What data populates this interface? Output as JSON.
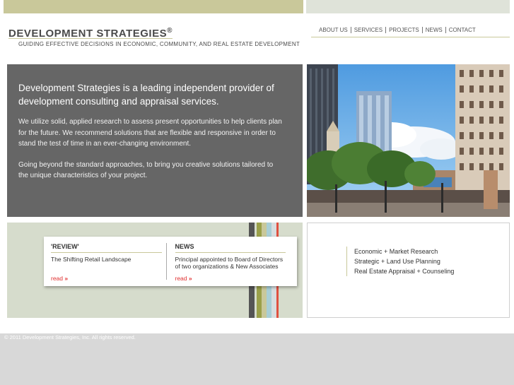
{
  "header": {
    "logo_text": "DEVELOPMENT STRATEGIES",
    "logo_mark": "®",
    "tagline": "GUIDING EFFECTIVE DECISIONS IN ECONOMIC, COMMUNITY, AND REAL ESTATE DEVELOPMENT"
  },
  "nav": {
    "items": [
      {
        "label": "ABOUT US"
      },
      {
        "label": "SERVICES"
      },
      {
        "label": "PROJECTS"
      },
      {
        "label": "NEWS"
      },
      {
        "label": "CONTACT"
      }
    ]
  },
  "hero": {
    "headline": "Development Strategies is a leading independent provider of development consulting and appraisal services.",
    "para1": "We utilize solid, applied research to assess present opportunities to help clients plan for the future. We recommend solutions that are flexible and responsive in order to stand the test of time in an ever-changing environment.",
    "para2": "Going beyond the standard approaches, to bring you creative solutions tailored to the unique characteristics of your project."
  },
  "cards": {
    "review": {
      "heading": "'REVIEW'",
      "text": "The Shifting Retail Landscape",
      "read": "read",
      "chevron": "»"
    },
    "news": {
      "heading": "NEWS",
      "text": "Principal appointed to Board of Directors of two organizations & New Associates",
      "read": "read",
      "chevron": "»"
    }
  },
  "services": {
    "items": [
      {
        "label": "Economic + Market Research"
      },
      {
        "label": "Strategic + Land Use Planning"
      },
      {
        "label": "Real Estate Appraisal + Counseling"
      }
    ]
  },
  "footer": {
    "copyright": "© 2011 Development Strategies, Inc.  All rights reserved."
  },
  "colors": {
    "olive": "#c9c89a",
    "hero_bg": "#666666",
    "panel_bg": "#d6dccc",
    "read_link": "#e03030",
    "stripes": [
      "#555555",
      "#9aa04a",
      "#c9c89a",
      "#a9cfd6",
      "#d8dee0",
      "#e05040"
    ]
  }
}
